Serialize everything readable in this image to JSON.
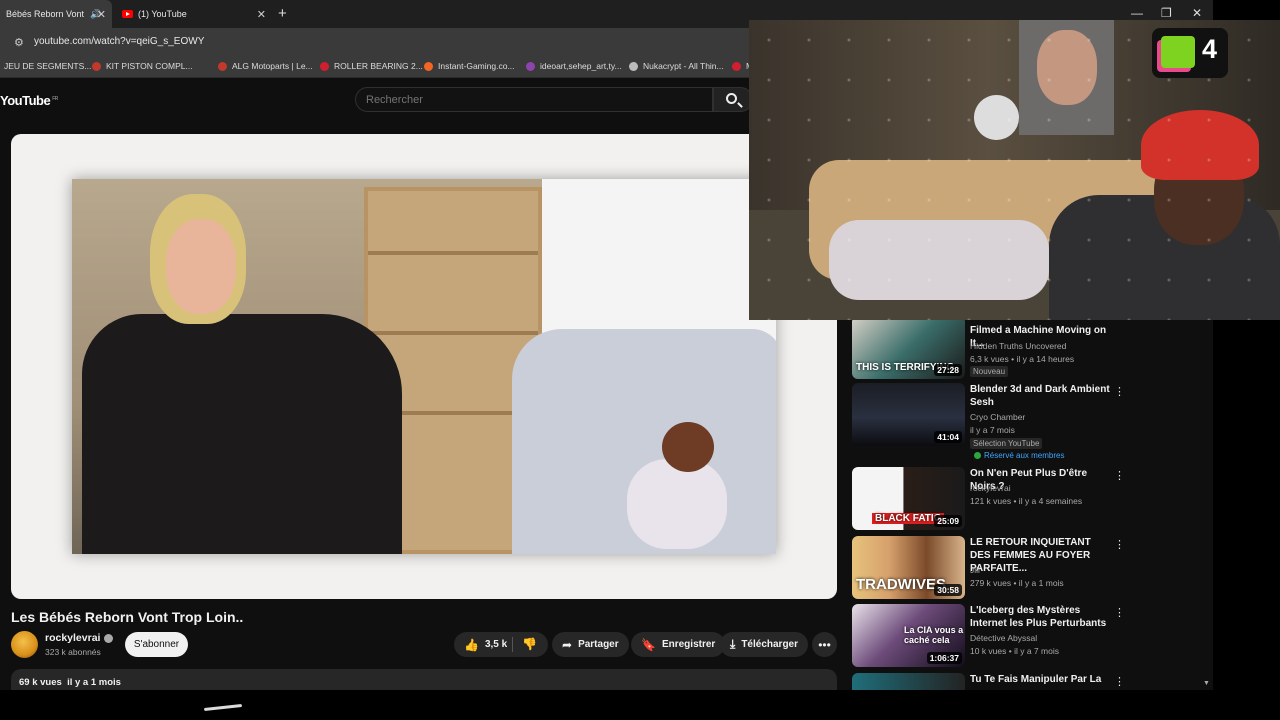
{
  "tabs": [
    {
      "label": "Bébés Reborn Vont",
      "close": "✕"
    },
    {
      "label": "(1) YouTube",
      "close": "✕"
    }
  ],
  "new_tab": "+",
  "window_controls": {
    "minimize": "—",
    "restore": "❐",
    "close": "✕"
  },
  "address": {
    "url": "youtube.com/watch?v=qeiG_s_EOWY"
  },
  "bookmarks": [
    {
      "label": "JEU DE SEGMENTS...",
      "color": ""
    },
    {
      "label": "KIT PISTON COMPL...",
      "color": "#c0392b"
    },
    {
      "label": "ALG Motoparts | Le...",
      "color": "#c0392b"
    },
    {
      "label": "ROLLER BEARING 2...",
      "color": "#d01f2f"
    },
    {
      "label": "Instant-Gaming.co...",
      "color": "#f26522"
    },
    {
      "label": "ideoart,sehep_art,ty...",
      "color": "#8e44ad"
    },
    {
      "label": "Nukacrypt - All Thin...",
      "color": "#bbbbbb"
    },
    {
      "label": "M E",
      "color": "#d01f2f"
    }
  ],
  "youtube": {
    "logo": "YouTube",
    "logo_region": "FR",
    "search_placeholder": "Rechercher"
  },
  "video": {
    "title": "Les Bébés Reborn Vont Trop Loin..",
    "channel": "rockylevrai",
    "subscribers": "323 k abonnés",
    "subscribe_label": "S'abonner",
    "likes": "3,5 k",
    "share_label": "Partager",
    "save_label": "Enregistrer",
    "download_label": "Télécharger",
    "more": "•••",
    "views": "69 k vues",
    "age": "il y a 1 mois"
  },
  "recommendations": [
    {
      "title": "Filmed a Machine Moving on It...",
      "channel": "Hidden Truths Uncovered",
      "meta": "6,3 k vues • il y a 14 heures",
      "badge": "Nouveau",
      "duration": "27:28",
      "thumb_text": "THIS IS TERRIFYING",
      "members": ""
    },
    {
      "title": "Blender 3d and Dark Ambient Sesh",
      "channel": "Cryo Chamber",
      "meta": "il y a 7 mois",
      "badge": "Sélection YouTube",
      "duration": "41:04",
      "thumb_text": "",
      "members": "Réservé aux membres"
    },
    {
      "title": "On N'en Peut Plus D'être Noirs ?",
      "channel": "rockylevrai",
      "meta": "121 k vues • il y a 4 semaines",
      "badge": "",
      "duration": "25:09",
      "thumb_text": "BLACK FATIG",
      "members": ""
    },
    {
      "title": "LE RETOUR INQUIETANT DES FEMMES AU FOYER PARFAITE...",
      "channel": "Jill",
      "meta": "279 k vues • il y a 1 mois",
      "badge": "",
      "duration": "30:58",
      "thumb_text": "TRADWIVES",
      "members": ""
    },
    {
      "title": "L'Iceberg des Mystères Internet les Plus Perturbants",
      "channel": "Détective Abyssal",
      "meta": "10 k vues • il y a 7 mois",
      "badge": "",
      "duration": "1:06:37",
      "thumb_text": "La CIA vous a caché cela",
      "members": ""
    },
    {
      "title": "Tu Te Fais Manipuler Par La",
      "channel": "",
      "meta": "",
      "badge": "",
      "duration": "",
      "thumb_text": "",
      "members": ""
    }
  ],
  "webcam": {
    "sticker_number": "4"
  },
  "colors": {
    "accent_red": "#ff0000",
    "background": "#0f0f0f",
    "pill": "#272727",
    "members_green": "#2ba640"
  }
}
